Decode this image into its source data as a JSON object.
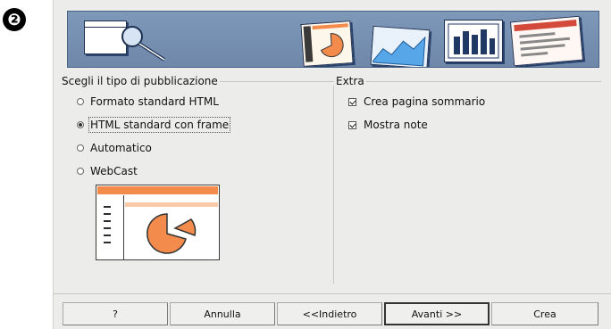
{
  "step_marker": "❷",
  "publication_type": {
    "title": "Scegli il tipo di pubblicazione",
    "options": [
      {
        "label": "Formato standard HTML",
        "selected": false
      },
      {
        "label": "HTML standard con frame",
        "selected": true
      },
      {
        "label": "Automatico",
        "selected": false
      },
      {
        "label": "WebCast",
        "selected": false
      }
    ]
  },
  "extra": {
    "title": "Extra",
    "options": [
      {
        "label": "Crea pagina sommario",
        "checked": true
      },
      {
        "label": "Mostra note",
        "checked": true
      }
    ]
  },
  "buttons": {
    "help": "?",
    "cancel": "Annulla",
    "back": "<<Indietro",
    "next": "Avanti >>",
    "create": "Crea"
  },
  "colors": {
    "banner": "#7a94b6",
    "dialog_bg": "#ececea",
    "accent_orange": "#f28b4b"
  }
}
